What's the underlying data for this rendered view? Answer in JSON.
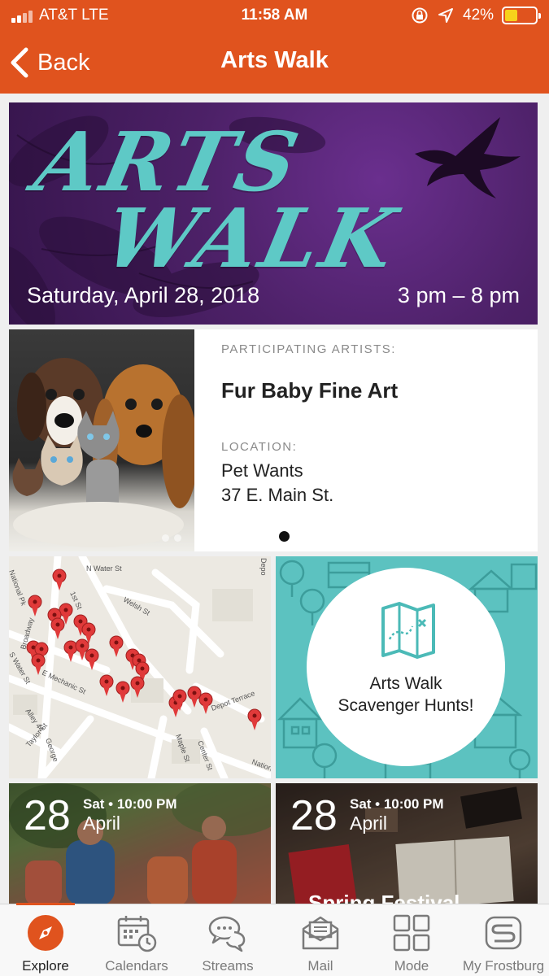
{
  "status_bar": {
    "carrier": "AT&T  LTE",
    "time": "11:58 AM",
    "battery": "42%",
    "battery_level": 0.42
  },
  "header": {
    "back_label": "Back",
    "title": "Arts Walk",
    "bg_color": "#e0531e"
  },
  "banner": {
    "word1": "ARTS",
    "word2": "WALK",
    "date": "Saturday, April 28, 2018",
    "time": "3 pm – 8 pm"
  },
  "artist_card": {
    "artists_label": "PARTICIPATING ARTISTS:",
    "artist_name": "Fur Baby Fine Art",
    "location_label": "LOCATION:",
    "location_name": "Pet Wants",
    "location_address": "37 E. Main St."
  },
  "map": {
    "streets": [
      "N Water St",
      "S Water St",
      "1st St",
      "Welsh St",
      "E Mechanic St",
      "Broadway",
      "Depot Terrace",
      "Maple St",
      "Center St",
      "Alley 44",
      "Taylor St",
      "George",
      "National Pk",
      "Depo",
      "Nation"
    ],
    "pin_color": "#e03a3a"
  },
  "scavenger": {
    "line1": "Arts Walk",
    "line2": "Scavenger Hunts!"
  },
  "events": [
    {
      "day": "28",
      "meta": "Sat • 10:00 PM",
      "month": "April",
      "partial_title": ""
    },
    {
      "day": "28",
      "meta": "Sat • 10:00 PM",
      "month": "April",
      "partial_title": "Spring Festival"
    }
  ],
  "tabs": [
    {
      "label": "Explore",
      "icon": "compass-icon",
      "active": true
    },
    {
      "label": "Calendars",
      "icon": "calendar-icon",
      "active": false
    },
    {
      "label": "Streams",
      "icon": "chat-bubbles-icon",
      "active": false
    },
    {
      "label": "Mail",
      "icon": "mail-icon",
      "active": false
    },
    {
      "label": "Mode",
      "icon": "grid-icon",
      "active": false
    },
    {
      "label": "My Frostburg",
      "icon": "frostburg-logo-icon",
      "active": false
    }
  ]
}
